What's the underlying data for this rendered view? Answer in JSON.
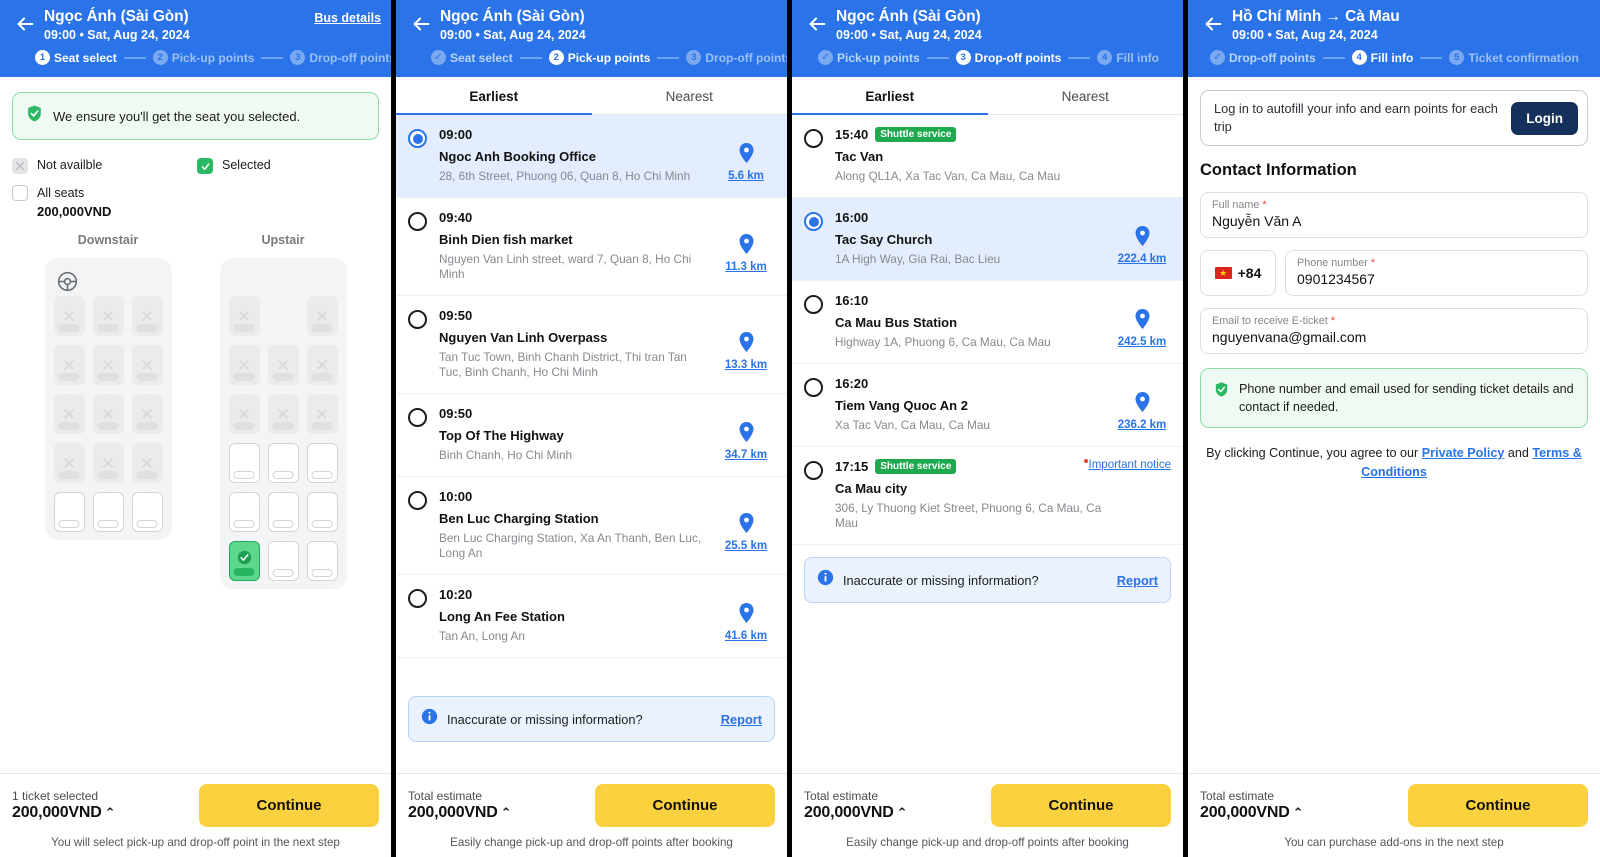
{
  "panels": {
    "seat_select": {
      "header": {
        "title": "Ngọc Ánh (Sài Gòn)",
        "subtitle": "09:00 • Sat, Aug 24, 2024",
        "link": "Bus details",
        "steps": [
          {
            "num": "1",
            "label": "Seat select",
            "state": "active"
          },
          {
            "num": "2",
            "label": "Pick-up points",
            "state": "todo"
          },
          {
            "num": "3",
            "label": "Drop-off points",
            "state": "todo"
          }
        ]
      },
      "ensure_banner": "We ensure you'll get the seat you selected.",
      "legend": {
        "not_available": "Not availble",
        "selected": "Selected",
        "all_seats": "All seats",
        "all_seats_price": "200,000VND"
      },
      "decks": [
        {
          "title": "Downstair",
          "has_wheel": true,
          "rows": [
            [
              "na",
              "na",
              "na"
            ],
            [
              "na",
              "na",
              "na"
            ],
            [
              "na",
              "na",
              "na"
            ],
            [
              "na",
              "na",
              "na"
            ],
            [
              "free",
              "free",
              "free"
            ]
          ]
        },
        {
          "title": "Upstair",
          "has_wheel": false,
          "rows": [
            [
              "na",
              "empty",
              "na"
            ],
            [
              "na",
              "na",
              "na"
            ],
            [
              "na",
              "na",
              "na"
            ],
            [
              "free",
              "free",
              "free"
            ],
            [
              "free",
              "free",
              "free"
            ],
            [
              "sel",
              "free",
              "free"
            ]
          ]
        }
      ],
      "footer": {
        "label": "1 ticket selected",
        "price": "200,000VND",
        "caret": "⌃",
        "button": "Continue",
        "note": "You will select pick-up and drop-off point in the next step"
      }
    },
    "pickup": {
      "header": {
        "title": "Ngọc Ánh (Sài Gòn)",
        "subtitle": "09:00 • Sat, Aug 24, 2024",
        "steps": [
          {
            "num": "✓",
            "label": "Seat select",
            "state": "done"
          },
          {
            "num": "2",
            "label": "Pick-up points",
            "state": "active"
          },
          {
            "num": "3",
            "label": "Drop-off points",
            "state": "todo"
          }
        ]
      },
      "tabs": [
        {
          "label": "Earliest",
          "active": true
        },
        {
          "label": "Nearest",
          "active": false
        }
      ],
      "stops": [
        {
          "time": "09:00",
          "name": "Ngoc Anh Booking Office",
          "address": "28, 6th Street, Phuong 06, Quan 8, Ho Chi Minh",
          "distance": "5.6 km",
          "selected": true
        },
        {
          "time": "09:40",
          "name": "Binh Dien fish market",
          "address": "Nguyen Van Linh street, ward 7, Quan 8, Ho Chi Minh",
          "distance": "11.3 km",
          "selected": false
        },
        {
          "time": "09:50",
          "name": "Nguyen Van Linh Overpass",
          "address": "Tan Tuc Town, Binh Chanh District, Thi tran Tan Tuc, Binh Chanh, Ho Chi Minh",
          "distance": "13.3 km",
          "selected": false
        },
        {
          "time": "09:50",
          "name": "Top Of The Highway",
          "address": "Binh Chanh, Ho Chi Minh",
          "distance": "34.7 km",
          "selected": false
        },
        {
          "time": "10:00",
          "name": "Ben Luc Charging Station",
          "address": "Ben Luc Charging Station, Xa An Thanh, Ben Luc, Long An",
          "distance": "25.5 km",
          "selected": false
        },
        {
          "time": "10:20",
          "name": "Long An Fee Station",
          "address": "Tan An, Long An",
          "distance": "41.6 km",
          "selected": false
        }
      ],
      "report": {
        "text": "Inaccurate or missing information?",
        "link": "Report"
      },
      "footer": {
        "label": "Total estimate",
        "price": "200,000VND",
        "caret": "⌃",
        "button": "Continue",
        "note": "Easily change pick-up and drop-off points after booking"
      }
    },
    "dropoff": {
      "header": {
        "title": "Ngọc Ánh (Sài Gòn)",
        "subtitle": "09:00 • Sat, Aug 24, 2024",
        "steps": [
          {
            "num": "✓",
            "label": "Pick-up points",
            "state": "done"
          },
          {
            "num": "3",
            "label": "Drop-off points",
            "state": "active"
          },
          {
            "num": "4",
            "label": "Fill info",
            "state": "todo"
          }
        ]
      },
      "tabs": [
        {
          "label": "Earliest",
          "active": true
        },
        {
          "label": "Nearest",
          "active": false
        }
      ],
      "stops": [
        {
          "time": "15:40",
          "badge": "Shuttle service",
          "name": "Tac Van",
          "address": "Along QL1A, Xa Tac Van, Ca Mau, Ca Mau",
          "distance": "",
          "selected": false
        },
        {
          "time": "16:00",
          "name": "Tac Say Church",
          "address": "1A High Way, Gia Rai, Bac Lieu",
          "distance": "222.4 km",
          "selected": true
        },
        {
          "time": "16:10",
          "name": "Ca Mau Bus Station",
          "address": "Highway 1A, Phuong 6, Ca Mau, Ca Mau",
          "distance": "242.5 km",
          "selected": false
        },
        {
          "time": "16:20",
          "name": "Tiem Vang Quoc An 2",
          "address": "Xa Tac Van, Ca Mau, Ca Mau",
          "distance": "236.2 km",
          "selected": false
        },
        {
          "time": "17:15",
          "badge": "Shuttle service",
          "notice": "Important notice",
          "name": "Ca Mau city",
          "address": "306, Ly Thuong Kiet Street, Phuong 6, Ca Mau, Ca Mau",
          "distance": "",
          "selected": false
        }
      ],
      "report": {
        "text": "Inaccurate or missing information?",
        "link": "Report"
      },
      "footer": {
        "label": "Total estimate",
        "price": "200,000VND",
        "caret": "⌃",
        "button": "Continue",
        "note": "Easily change pick-up and drop-off points after booking"
      }
    },
    "fillinfo": {
      "header": {
        "title": "Hồ Chí Minh → Cà Mau",
        "subtitle": "09:00 • Sat, Aug 24, 2024",
        "steps": [
          {
            "num": "✓",
            "label": "Drop-off points",
            "state": "done"
          },
          {
            "num": "4",
            "label": "Fill info",
            "state": "active"
          },
          {
            "num": "5",
            "label": "Ticket confirmation",
            "state": "todo"
          }
        ]
      },
      "login_prompt": "Log in to autofill your info and earn points for each trip",
      "login_button": "Login",
      "section_title": "Contact Information",
      "fields": {
        "full_name": {
          "label": "Full name",
          "value": "Nguyễn Văn A",
          "required": true
        },
        "country_code": {
          "value": "+84"
        },
        "phone": {
          "label": "Phone number",
          "value": "0901234567",
          "required": true
        },
        "email": {
          "label": "Email to receive E-ticket",
          "value": "nguyenvana@gmail.com",
          "required": true
        }
      },
      "green_note": "Phone number and email used for sending ticket details and contact if needed.",
      "agree": {
        "prefix": "By clicking Continue, you agree to our ",
        "link1": "Private Policy",
        "middle": " and ",
        "link2": "Terms & Conditions"
      },
      "footer": {
        "label": "Total estimate",
        "price": "200,000VND",
        "caret": "⌃",
        "button": "Continue",
        "note": "You can purchase add-ons in the next step"
      }
    }
  }
}
